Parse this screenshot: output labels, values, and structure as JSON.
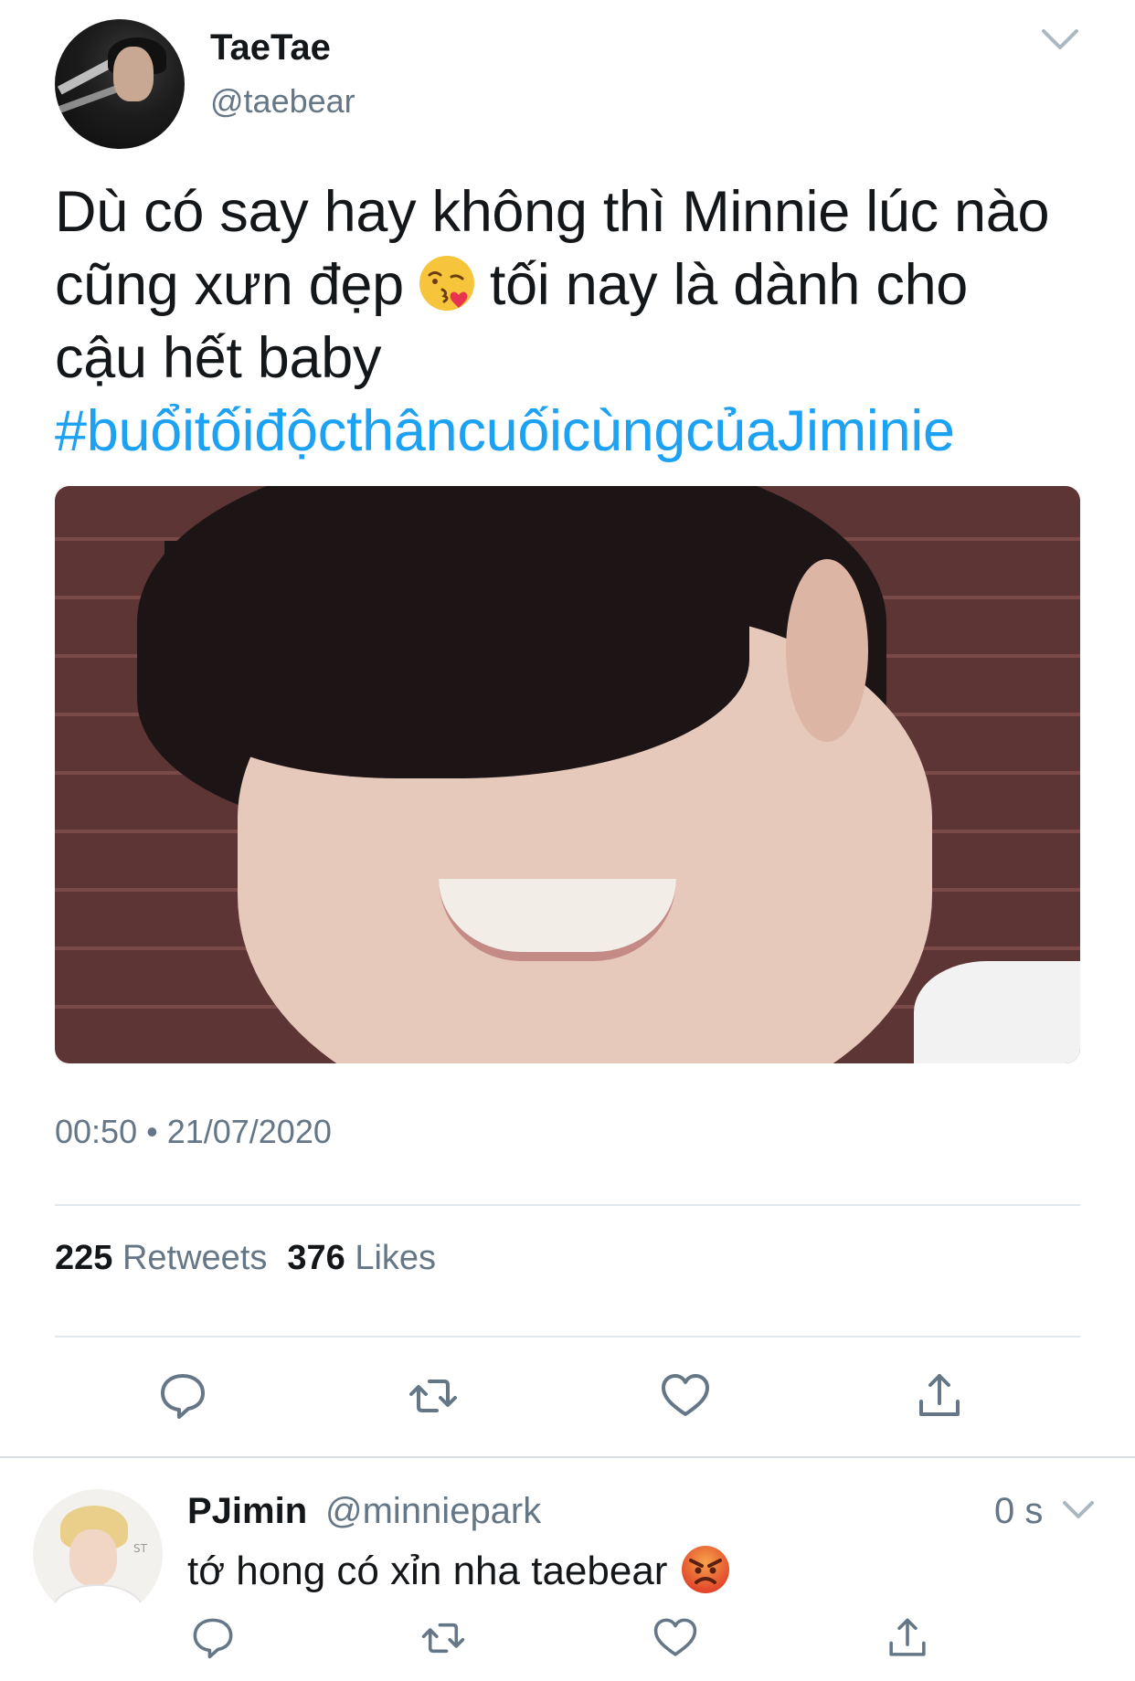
{
  "tweet": {
    "author": {
      "name": "TaeTae",
      "handle": "@taebear"
    },
    "text_lines": [
      "Dù có say hay không thì Minnie lúc nào",
      "cũng xưn đẹp",
      "tối nay là dành cho",
      "cậu hết baby"
    ],
    "hashtag": "#buổitốiđộcthâncuốicùngcủaJiminie",
    "emoji": "face-blowing-a-kiss",
    "timestamp": "00:50 • 21/07/2020",
    "stats": {
      "retweets_count": "225",
      "retweets_label": "Retweets",
      "likes_count": "376",
      "likes_label": "Likes"
    },
    "actions": [
      "reply-icon",
      "retweet-icon",
      "like-icon",
      "share-icon"
    ]
  },
  "reply": {
    "author": {
      "name": "PJimin",
      "handle": "@minniepark"
    },
    "time": "0 s",
    "text": "tớ hong có xỉn nha taebear",
    "emoji": "angry-face",
    "avatar_logo": "ST",
    "actions": [
      "reply-icon",
      "retweet-icon",
      "like-icon",
      "share-icon"
    ]
  },
  "colors": {
    "text": "#14171a",
    "secondary": "#657786",
    "link": "#1da1f2",
    "divider": "#e1e8ed"
  }
}
